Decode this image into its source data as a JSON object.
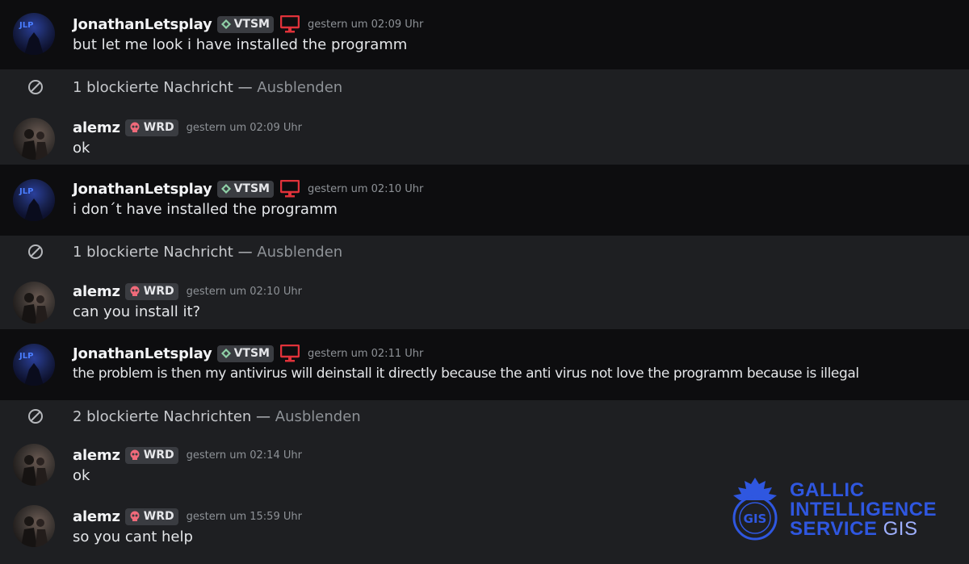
{
  "rows": [
    {
      "type": "message",
      "user": "JonathanLetsplay",
      "tag": "VTSM",
      "time": "gestern um 02:09 Uhr",
      "text": "but let me look i have installed the programm"
    },
    {
      "type": "blocked",
      "label": "1 blockierte Nachricht",
      "hide": "Ausblenden"
    },
    {
      "type": "message",
      "user": "alemz",
      "tag": "WRD",
      "time": "gestern um 02:09 Uhr",
      "text": "ok"
    },
    {
      "type": "message",
      "user": "JonathanLetsplay",
      "tag": "VTSM",
      "time": "gestern um 02:10 Uhr",
      "text": "i don´t have installed the programm"
    },
    {
      "type": "blocked",
      "label": "1 blockierte Nachricht",
      "hide": "Ausblenden"
    },
    {
      "type": "message",
      "user": "alemz",
      "tag": "WRD",
      "time": "gestern um 02:10 Uhr",
      "text": "can you install it?"
    },
    {
      "type": "message",
      "user": "JonathanLetsplay",
      "tag": "VTSM",
      "time": "gestern um 02:11 Uhr",
      "text": "the problem is then my antivirus will deinstall it directly because the anti virus not love the programm because is illegal"
    },
    {
      "type": "blocked",
      "label": "2 blockierte Nachrichten",
      "hide": "Ausblenden"
    },
    {
      "type": "message",
      "user": "alemz",
      "tag": "WRD",
      "time": "gestern um 02:14 Uhr",
      "text": "ok"
    },
    {
      "type": "message",
      "user": "alemz",
      "tag": "WRD",
      "time": "gestern um 15:59 Uhr",
      "text": "so you cant help"
    }
  ],
  "watermark": {
    "line1": "GALLIC",
    "line2": "INTELLIGENCE",
    "line3": "SERVICE",
    "line3b": "GIS",
    "seal_text": "GIS"
  },
  "dash": "—",
  "colors": {
    "brand": "#2f57e0",
    "monitor": "#e0323a",
    "blocked_text": "#c7c9cd",
    "muted": "#8e9297"
  }
}
